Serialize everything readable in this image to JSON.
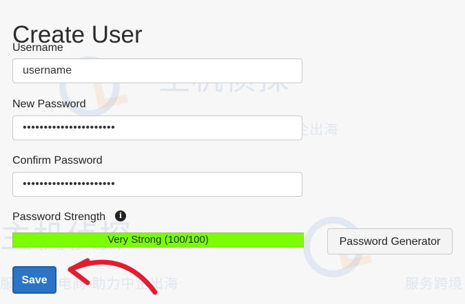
{
  "page": {
    "title": "Create User"
  },
  "form": {
    "username": {
      "label": "Username",
      "value": "username"
    },
    "new_password": {
      "label": "New Password",
      "value": "••••••••••••••••••••••"
    },
    "confirm_password": {
      "label": "Confirm Password",
      "value": "••••••••••••••••••••••"
    },
    "password_strength": {
      "label": "Password Strength",
      "info_icon": "info-icon",
      "value_text": "Very Strong (100/100)",
      "score": 100,
      "max_score": 100
    },
    "buttons": {
      "password_generator": "Password Generator",
      "save": "Save"
    }
  },
  "watermark": {
    "brand_large": "主机侦探",
    "brand_small": "服务跨境电商 助力中企出海",
    "brand_small_right": "服务跨境"
  },
  "colors": {
    "background": "#f7f7f8",
    "strength_fill": "#7cfc00",
    "save_button": "#2c74c6",
    "annotation_arrow": "#e11d2f"
  }
}
